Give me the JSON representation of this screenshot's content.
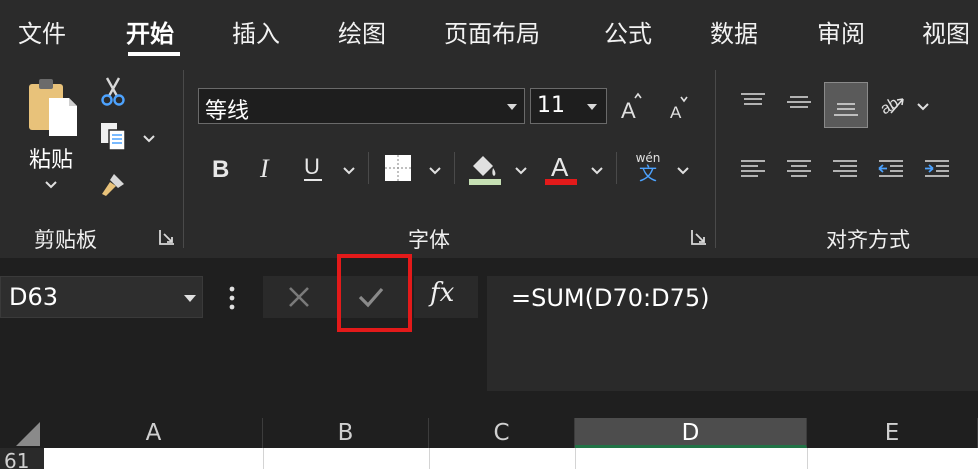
{
  "menu": {
    "tabs": [
      {
        "label": "文件"
      },
      {
        "label": "开始",
        "active": true
      },
      {
        "label": "插入"
      },
      {
        "label": "绘图"
      },
      {
        "label": "页面布局"
      },
      {
        "label": "公式"
      },
      {
        "label": "数据"
      },
      {
        "label": "审阅"
      },
      {
        "label": "视图"
      }
    ]
  },
  "ribbon": {
    "clipboard": {
      "label": "剪贴板",
      "paste_label": "粘贴"
    },
    "font": {
      "label": "字体",
      "font_name": "等线",
      "font_size": "11",
      "pinyin_label": "wén",
      "pinyin_char": "文",
      "fill_color": "#c6e0b4",
      "font_color": "#e31a1a"
    },
    "alignment": {
      "label": "对齐方式"
    }
  },
  "formula_bar": {
    "name_box": "D63",
    "fx_label": "fx",
    "formula": "=SUM(D70:D75)",
    "highlight_color": "#e31a1a"
  },
  "grid": {
    "columns": [
      "A",
      "B",
      "C",
      "D",
      "E"
    ],
    "selected_column": "D",
    "row_number": "61"
  }
}
